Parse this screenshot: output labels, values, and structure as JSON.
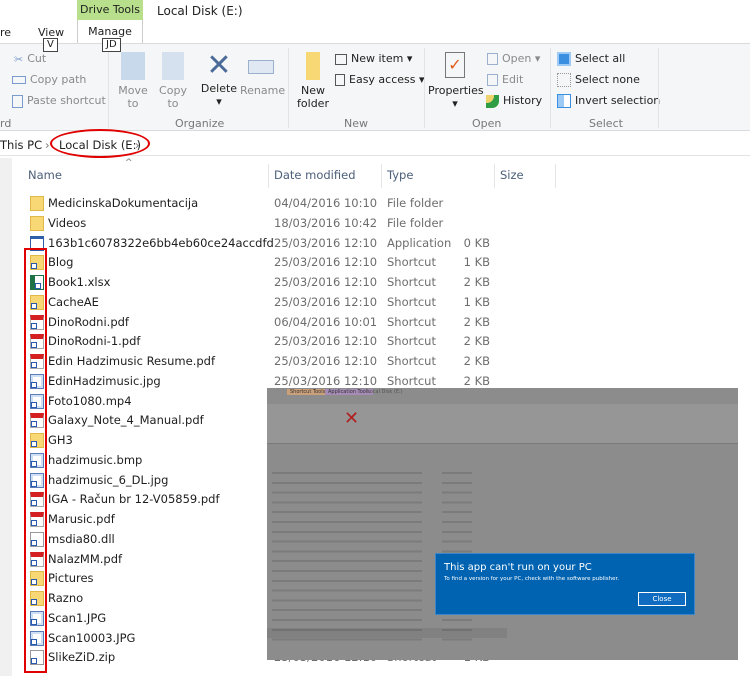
{
  "tabs": {
    "share": "re",
    "view": "View",
    "view_key": "V",
    "context_tab": "Drive Tools",
    "manage": "Manage",
    "manage_key": "JD",
    "window_title": "Local Disk (E:)"
  },
  "ribbon": {
    "clipboard": {
      "cut": "Cut",
      "copy_path": "Copy path",
      "paste_shortcut": "Paste shortcut",
      "label": "rd"
    },
    "organize": {
      "move_to": "Move",
      "move_to2": "to",
      "copy_to": "Copy",
      "copy_to2": "to",
      "delete": "Delete",
      "rename": "Rename",
      "label": "Organize"
    },
    "new": {
      "new_folder": "New",
      "new_folder2": "folder",
      "new_item": "New item",
      "easy_access": "Easy access",
      "label": "New"
    },
    "open": {
      "properties": "Properties",
      "open": "Open",
      "edit": "Edit",
      "history": "History",
      "label": "Open"
    },
    "select": {
      "select_all": "Select all",
      "select_none": "Select none",
      "invert": "Invert selection",
      "label": "Select"
    }
  },
  "address": {
    "crumbs": [
      "This PC",
      "Local Disk (E:)"
    ],
    "sep": "›"
  },
  "columns": {
    "name": "Name",
    "date": "Date modified",
    "type": "Type",
    "size": "Size"
  },
  "files": [
    {
      "name": "MedicinskaDokumentacija",
      "date": "04/04/2016 10:10",
      "type": "File folder",
      "size": "",
      "icon": "folder"
    },
    {
      "name": "Videos",
      "date": "18/03/2016 10:42",
      "type": "File folder",
      "size": "",
      "icon": "folder"
    },
    {
      "name": "163b1c6078322e6bb4eb60ce24accdfd",
      "date": "25/03/2016 12:10",
      "type": "Application",
      "size": "0 KB",
      "icon": "app"
    },
    {
      "name": "Blog",
      "date": "25/03/2016 12:10",
      "type": "Shortcut",
      "size": "1 KB",
      "icon": "folder-shortcut"
    },
    {
      "name": "Book1.xlsx",
      "date": "25/03/2016 12:10",
      "type": "Shortcut",
      "size": "2 KB",
      "icon": "xls-shortcut"
    },
    {
      "name": "CacheAE",
      "date": "25/03/2016 12:10",
      "type": "Shortcut",
      "size": "1 KB",
      "icon": "folder-shortcut"
    },
    {
      "name": "DinoRodni.pdf",
      "date": "06/04/2016 10:01",
      "type": "Shortcut",
      "size": "2 KB",
      "icon": "pdf-shortcut"
    },
    {
      "name": "DinoRodni-1.pdf",
      "date": "25/03/2016 12:10",
      "type": "Shortcut",
      "size": "2 KB",
      "icon": "pdf-shortcut"
    },
    {
      "name": "Edin Hadzimusic Resume.pdf",
      "date": "25/03/2016 12:10",
      "type": "Shortcut",
      "size": "2 KB",
      "icon": "pdf-shortcut"
    },
    {
      "name": "EdinHadzimusic.jpg",
      "date": "25/03/2016 12:10",
      "type": "Shortcut",
      "size": "2 KB",
      "icon": "img-shortcut"
    },
    {
      "name": "Foto1080.mp4",
      "icon": "img-shortcut"
    },
    {
      "name": "Galaxy_Note_4_Manual.pdf",
      "icon": "pdf-shortcut"
    },
    {
      "name": "GH3",
      "icon": "folder-shortcut"
    },
    {
      "name": "hadzimusic.bmp",
      "icon": "img-shortcut"
    },
    {
      "name": "hadzimusic_6_DL.jpg",
      "icon": "img-shortcut"
    },
    {
      "name": "IGA - Račun br 12-V05859.pdf",
      "icon": "pdf-shortcut"
    },
    {
      "name": "Marusic.pdf",
      "icon": "pdf-shortcut"
    },
    {
      "name": "msdia80.dll",
      "icon": "file-shortcut"
    },
    {
      "name": "NalazMM.pdf",
      "icon": "pdf-shortcut"
    },
    {
      "name": "Pictures",
      "icon": "folder-shortcut"
    },
    {
      "name": "Razno",
      "icon": "folder-shortcut"
    },
    {
      "name": "Scan1.JPG",
      "icon": "img-shortcut"
    },
    {
      "name": "Scan10003.JPG",
      "icon": "img-shortcut"
    },
    {
      "name": "SlikeZiD.zip",
      "date": "25/03/2016 12:10",
      "type": "Shortcut",
      "size": "1 KB",
      "icon": "file-shortcut"
    }
  ],
  "inset": {
    "tab1": "Shortcut Tools",
    "tab2": "Application Tools",
    "title": "Local Disk (E:)",
    "dialog_title": "This app can't run on your PC",
    "dialog_text": "To find a version for your PC, check with the software publisher.",
    "close": "Close"
  },
  "colors": {
    "annotation": "#e00000",
    "dialog": "#0063b1",
    "drive_tools_tab": "#b8e08c"
  }
}
